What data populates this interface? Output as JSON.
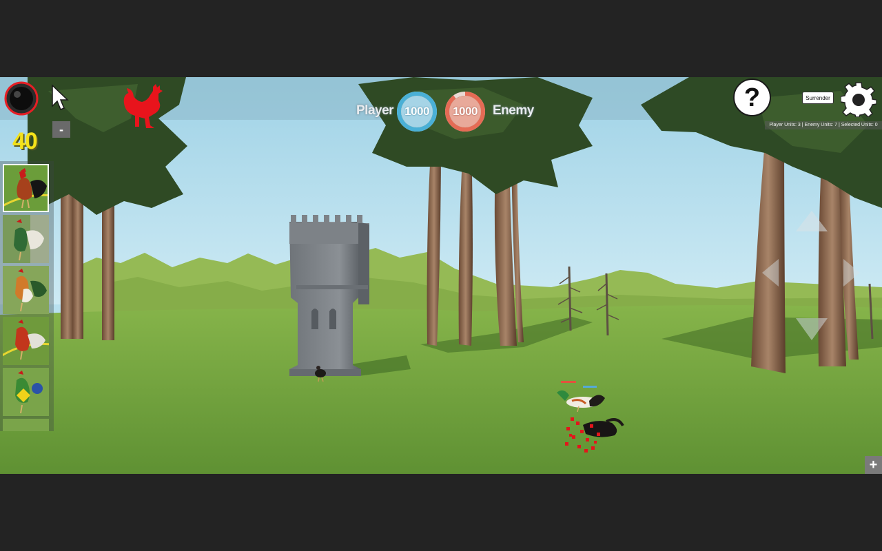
{
  "hud": {
    "resource_count": "40",
    "minus_label": "-",
    "plus_label": "+",
    "help_label": "?",
    "surrender_label": "Surrender",
    "player_label": "Player",
    "enemy_label": "Enemy",
    "player_health": "1000",
    "enemy_health": "1000",
    "player_health_fraction": 1.0,
    "enemy_health_fraction": 0.9,
    "stats": {
      "player_units": "Player Units: 3",
      "enemy_units": "Enemy Units: 7",
      "selected_units": "Selected Units: 0"
    }
  },
  "colors": {
    "player": "#4ab0d6",
    "enemy": "#e56b55",
    "resource_text": "#f4e21a",
    "team_flag": "#e8141c",
    "sky": "#b8e0ef",
    "grass": "#6fa23b"
  },
  "icons": {
    "timer": "bomb-timer-icon",
    "cursor": "pointer-cursor-icon",
    "team": "rooster-icon",
    "help": "question-icon",
    "settings": "gear-icon",
    "camera": "arrow-pad-icon"
  },
  "unit_cards": [
    {
      "name": "red-black-rooster-card",
      "selected": true
    },
    {
      "name": "green-white-rooster-card",
      "selected": false
    },
    {
      "name": "orange-white-rooster-card",
      "selected": false
    },
    {
      "name": "red-orange-rooster-card",
      "selected": false
    },
    {
      "name": "green-yellow-rooster-card",
      "selected": false
    }
  ]
}
